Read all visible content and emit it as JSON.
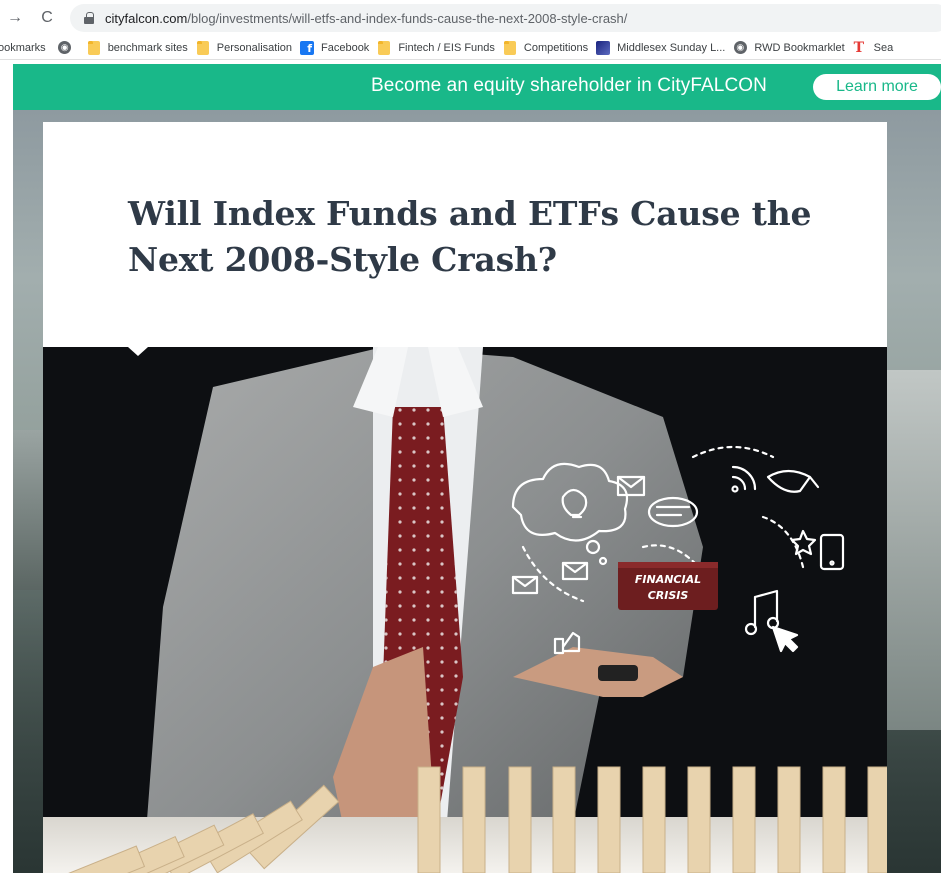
{
  "browser": {
    "url_domain": "cityfalcon.com",
    "url_path": "/blog/investments/will-etfs-and-index-funds-cause-the-next-2008-style-crash/"
  },
  "bookmarks": [
    {
      "label": "ookmarks",
      "icon": "none"
    },
    {
      "label": "",
      "icon": "globe-icon"
    },
    {
      "label": "benchmark sites",
      "icon": "folder-icon"
    },
    {
      "label": "Personalisation",
      "icon": "folder-icon"
    },
    {
      "label": "Facebook",
      "icon": "facebook-icon"
    },
    {
      "label": "Fintech / EIS Funds",
      "icon": "folder-icon"
    },
    {
      "label": "Competitions",
      "icon": "folder-icon"
    },
    {
      "label": "Middlesex Sunday L...",
      "icon": "middlesex-icon"
    },
    {
      "label": "RWD Bookmarklet",
      "icon": "globe-icon"
    },
    {
      "label": "Sea",
      "icon": "t-icon"
    }
  ],
  "promo": {
    "text": "Become an equity shareholder in CityFALCON",
    "button": "Learn more",
    "color": "#19b889"
  },
  "article": {
    "title": "Will Index Funds and ETFs Cause the Next 2008-Style Crash?",
    "image_label_line1": "FINANCIAL",
    "image_label_line2": "CRISIS"
  }
}
